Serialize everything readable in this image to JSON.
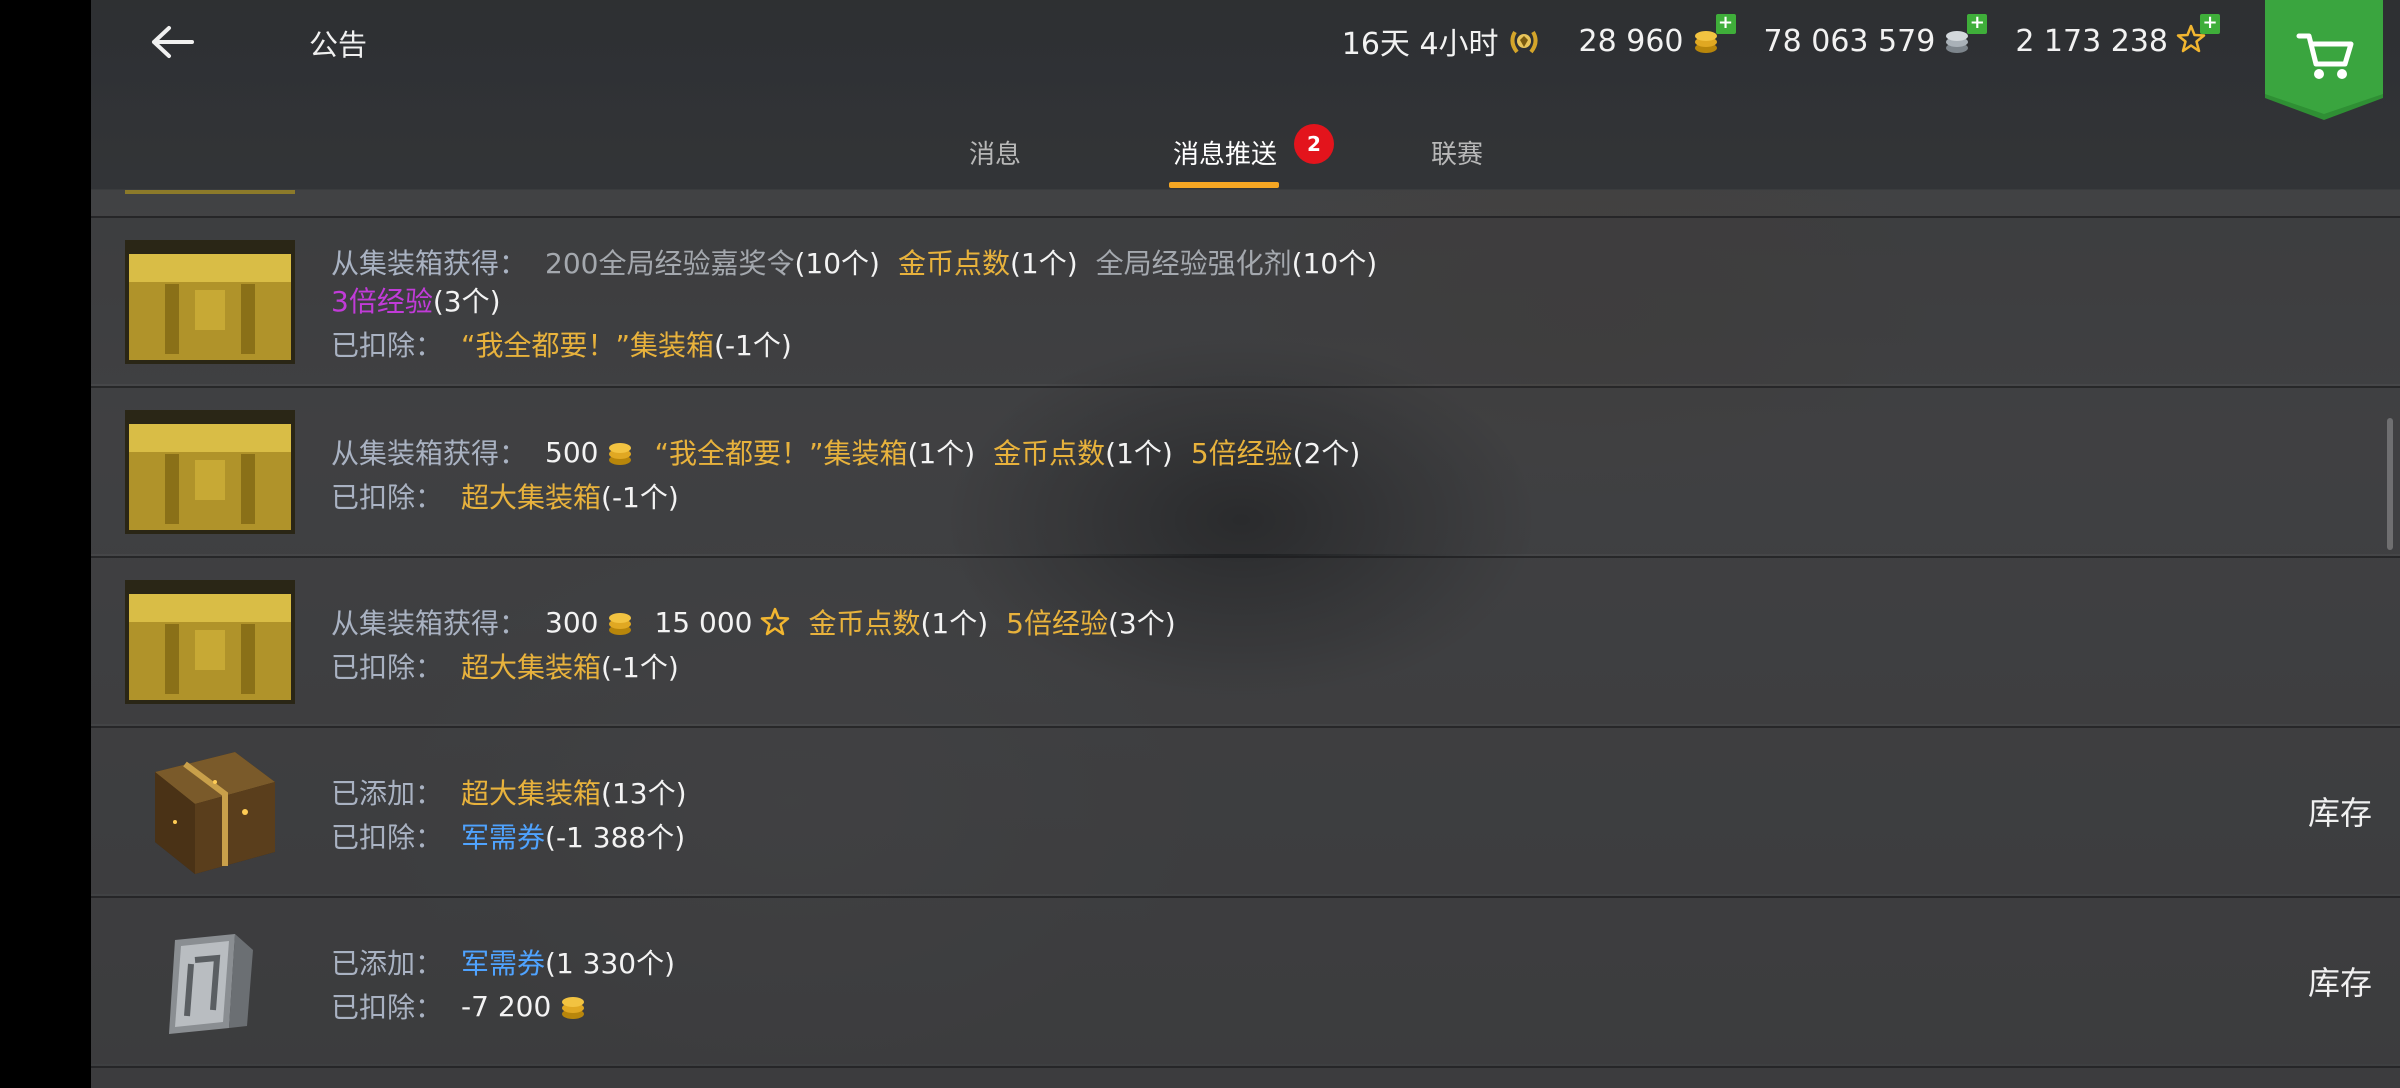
{
  "header": {
    "title": "公告",
    "currencies": {
      "premium_time": "16天 4小时",
      "gold": "28 960",
      "credits": "78 063 579",
      "free_xp": "2 173 238"
    }
  },
  "tabs": {
    "messages": "消息",
    "push": "消息推送",
    "push_badge": "2",
    "league": "联赛"
  },
  "labels": {
    "obtained_from_container": "从集装箱获得：",
    "deducted": "已扣除：",
    "added": "已添加："
  },
  "rows": [
    {
      "line1": [
        {
          "t": "200全局经验嘉奖令",
          "c": "gray"
        },
        {
          "t": "(10个)",
          "c": "white"
        },
        {
          "t": "金币点数",
          "c": "gold"
        },
        {
          "t": "(1个)",
          "c": "white"
        },
        {
          "t": "全局经验强化剂",
          "c": "gray"
        },
        {
          "t": "(10个)",
          "c": "white"
        }
      ],
      "line2": [
        {
          "t": "3倍经验",
          "c": "purple"
        },
        {
          "t": "(3个)",
          "c": "white"
        }
      ],
      "line3": [
        {
          "t": "“我全都要！”集装箱",
          "c": "gold"
        },
        {
          "t": "(-1个)",
          "c": "white"
        }
      ]
    },
    {
      "line1_amount": "500",
      "line1": [
        {
          "t": "“我全都要！”集装箱",
          "c": "gold"
        },
        {
          "t": "(1个)",
          "c": "white"
        },
        {
          "t": "金币点数",
          "c": "gold"
        },
        {
          "t": "(1个)",
          "c": "white"
        },
        {
          "t": "5倍经验",
          "c": "gold"
        },
        {
          "t": "(2个)",
          "c": "white"
        }
      ],
      "line2": [
        {
          "t": "超大集装箱",
          "c": "gold"
        },
        {
          "t": "(-1个)",
          "c": "white"
        }
      ]
    },
    {
      "line1_amount": "300",
      "line1_xp": "15 000",
      "line1": [
        {
          "t": "金币点数",
          "c": "gold"
        },
        {
          "t": "(1个)",
          "c": "white"
        },
        {
          "t": "5倍经验",
          "c": "gold"
        },
        {
          "t": "(3个)",
          "c": "white"
        }
      ],
      "line2": [
        {
          "t": "超大集装箱",
          "c": "gold"
        },
        {
          "t": "(-1个)",
          "c": "white"
        }
      ]
    },
    {
      "line1": [
        {
          "t": "超大集装箱",
          "c": "gold"
        },
        {
          "t": "(13个)",
          "c": "white"
        }
      ],
      "line2": [
        {
          "t": "军需券",
          "c": "blue"
        },
        {
          "t": "(-1 388个)",
          "c": "white"
        }
      ],
      "button": "库存"
    },
    {
      "line1": [
        {
          "t": "军需券",
          "c": "blue"
        },
        {
          "t": "(1 330个)",
          "c": "white"
        }
      ],
      "line2_amount": "-7 200",
      "button": "库存"
    }
  ],
  "icons": {
    "back": "arrow-left-icon",
    "premium": "premium-laurel-icon",
    "gold": "gold-coins-icon",
    "credits": "silver-coins-icon",
    "free_xp": "star-icon",
    "shop": "shopping-cart-icon",
    "container_gold": "gold-container-icon",
    "container_big": "big-container-icon",
    "ticket": "ticket-icon"
  },
  "colors": {
    "accent": "#f5a623",
    "gold_text": "#e8b23c",
    "blue_text": "#4fa3ff",
    "purple_text": "#c13bd8",
    "badge_red": "#e3141c",
    "shop_green": "#2f8f34"
  }
}
